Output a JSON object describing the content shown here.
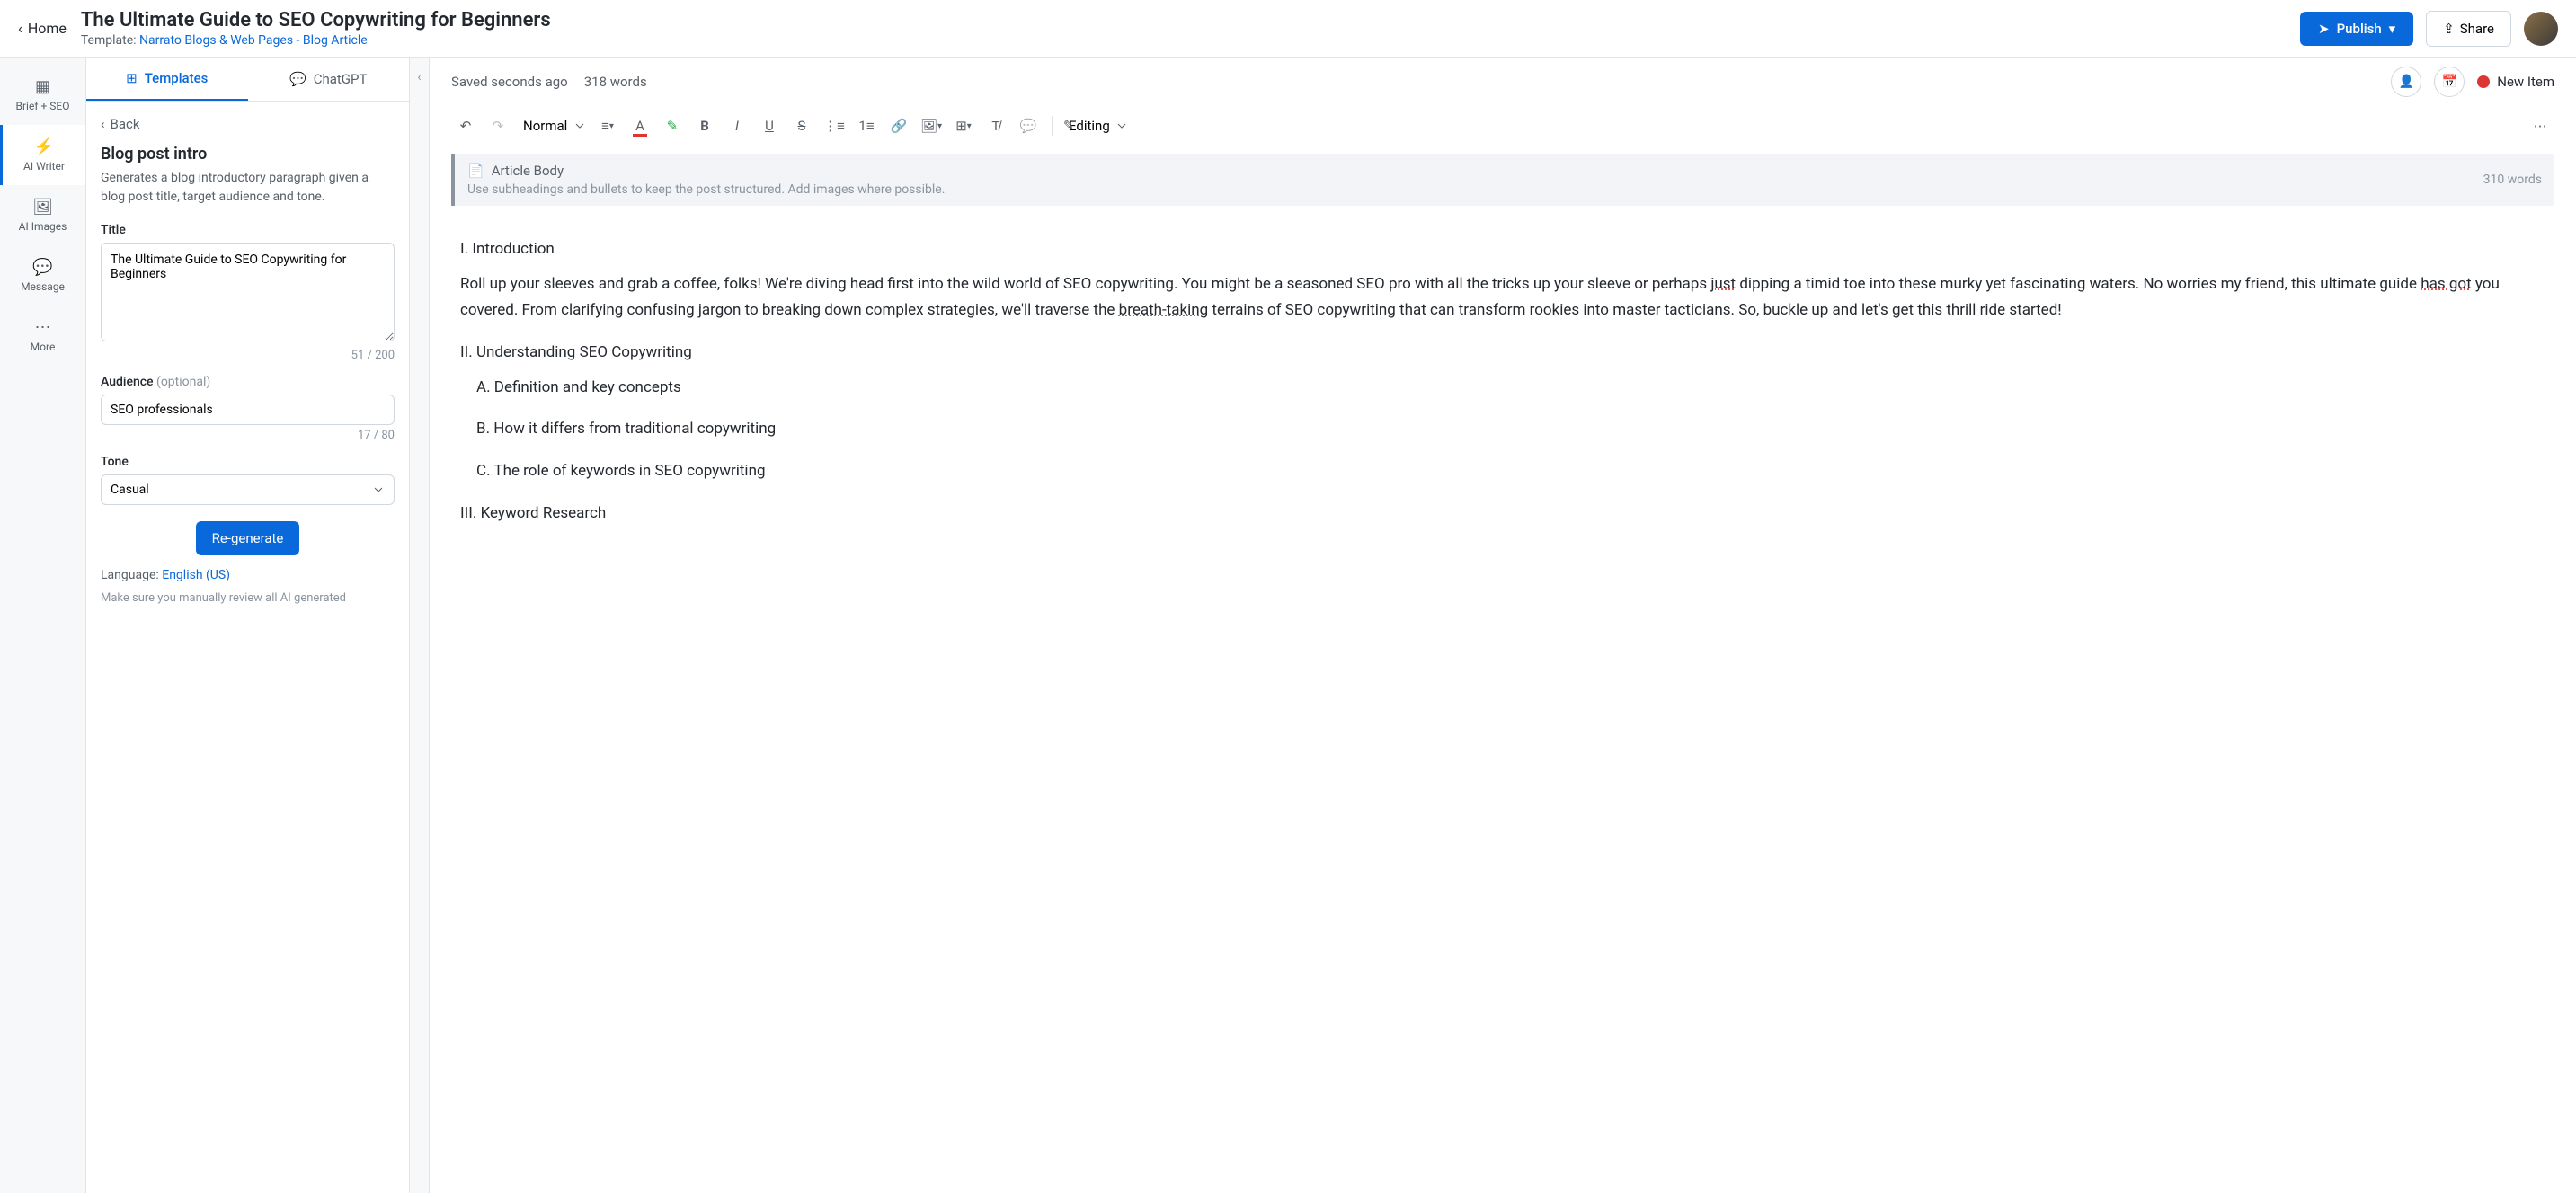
{
  "header": {
    "home": "Home",
    "title": "The Ultimate Guide to SEO Copywriting for Beginners",
    "template_prefix": "Template: ",
    "template_name": "Narrato Blogs & Web Pages - Blog Article",
    "publish": "Publish",
    "share": "Share"
  },
  "rail": {
    "brief": "Brief + SEO",
    "writer": "AI Writer",
    "images": "AI Images",
    "message": "Message",
    "more": "More"
  },
  "panel": {
    "tab_templates": "Templates",
    "tab_chatgpt": "ChatGPT",
    "back": "Back",
    "tool_title": "Blog post intro",
    "tool_desc": "Generates a blog introductory paragraph given a blog post title, target audience and tone.",
    "title_label": "Title",
    "title_value": "The Ultimate Guide to SEO Copywriting for Beginners",
    "title_count": "51 / 200",
    "audience_label": "Audience ",
    "audience_optional": "(optional)",
    "audience_value": "SEO professionals",
    "audience_count": "17 / 80",
    "tone_label": "Tone",
    "tone_value": "Casual",
    "regenerate": "Re-generate",
    "lang_prefix": "Language: ",
    "lang_value": "English (US)",
    "review_note": "Make sure you manually review all AI generated"
  },
  "editor": {
    "saved": "Saved seconds ago",
    "words": "318 words",
    "status": "New Item",
    "format": "Normal",
    "mode": "Editing",
    "section_title": "Article Body",
    "section_hint": "Use subheadings and bullets to keep the post structured. Add images where possible.",
    "section_words": "310 words",
    "body": {
      "p1": "I. Introduction",
      "p2a": "Roll up your sleeves and grab a coffee, folks! We're diving head first into the wild world of SEO copywriting. You might be a seasoned SEO pro with all the tricks up your sleeve or perhaps ",
      "p2b": "just",
      "p2c": " dipping a timid toe into these murky yet fascinating waters. No worries my friend, this ultimate guide ",
      "p2d": "has got",
      "p2e": " you covered. From clarifying confusing jargon to breaking down complex strategies, we'll traverse the ",
      "p2f": "breath-taking",
      "p2g": " terrains of SEO copywriting that can transform rookies into master tacticians. So, buckle up and let's get this thrill ride started!",
      "p3": "II. Understanding SEO Copywriting",
      "p4": "A. Definition and key concepts",
      "p5": "B. How it differs from traditional copywriting",
      "p6": "C. The role of keywords in SEO copywriting",
      "p7": "III. Keyword Research"
    }
  }
}
